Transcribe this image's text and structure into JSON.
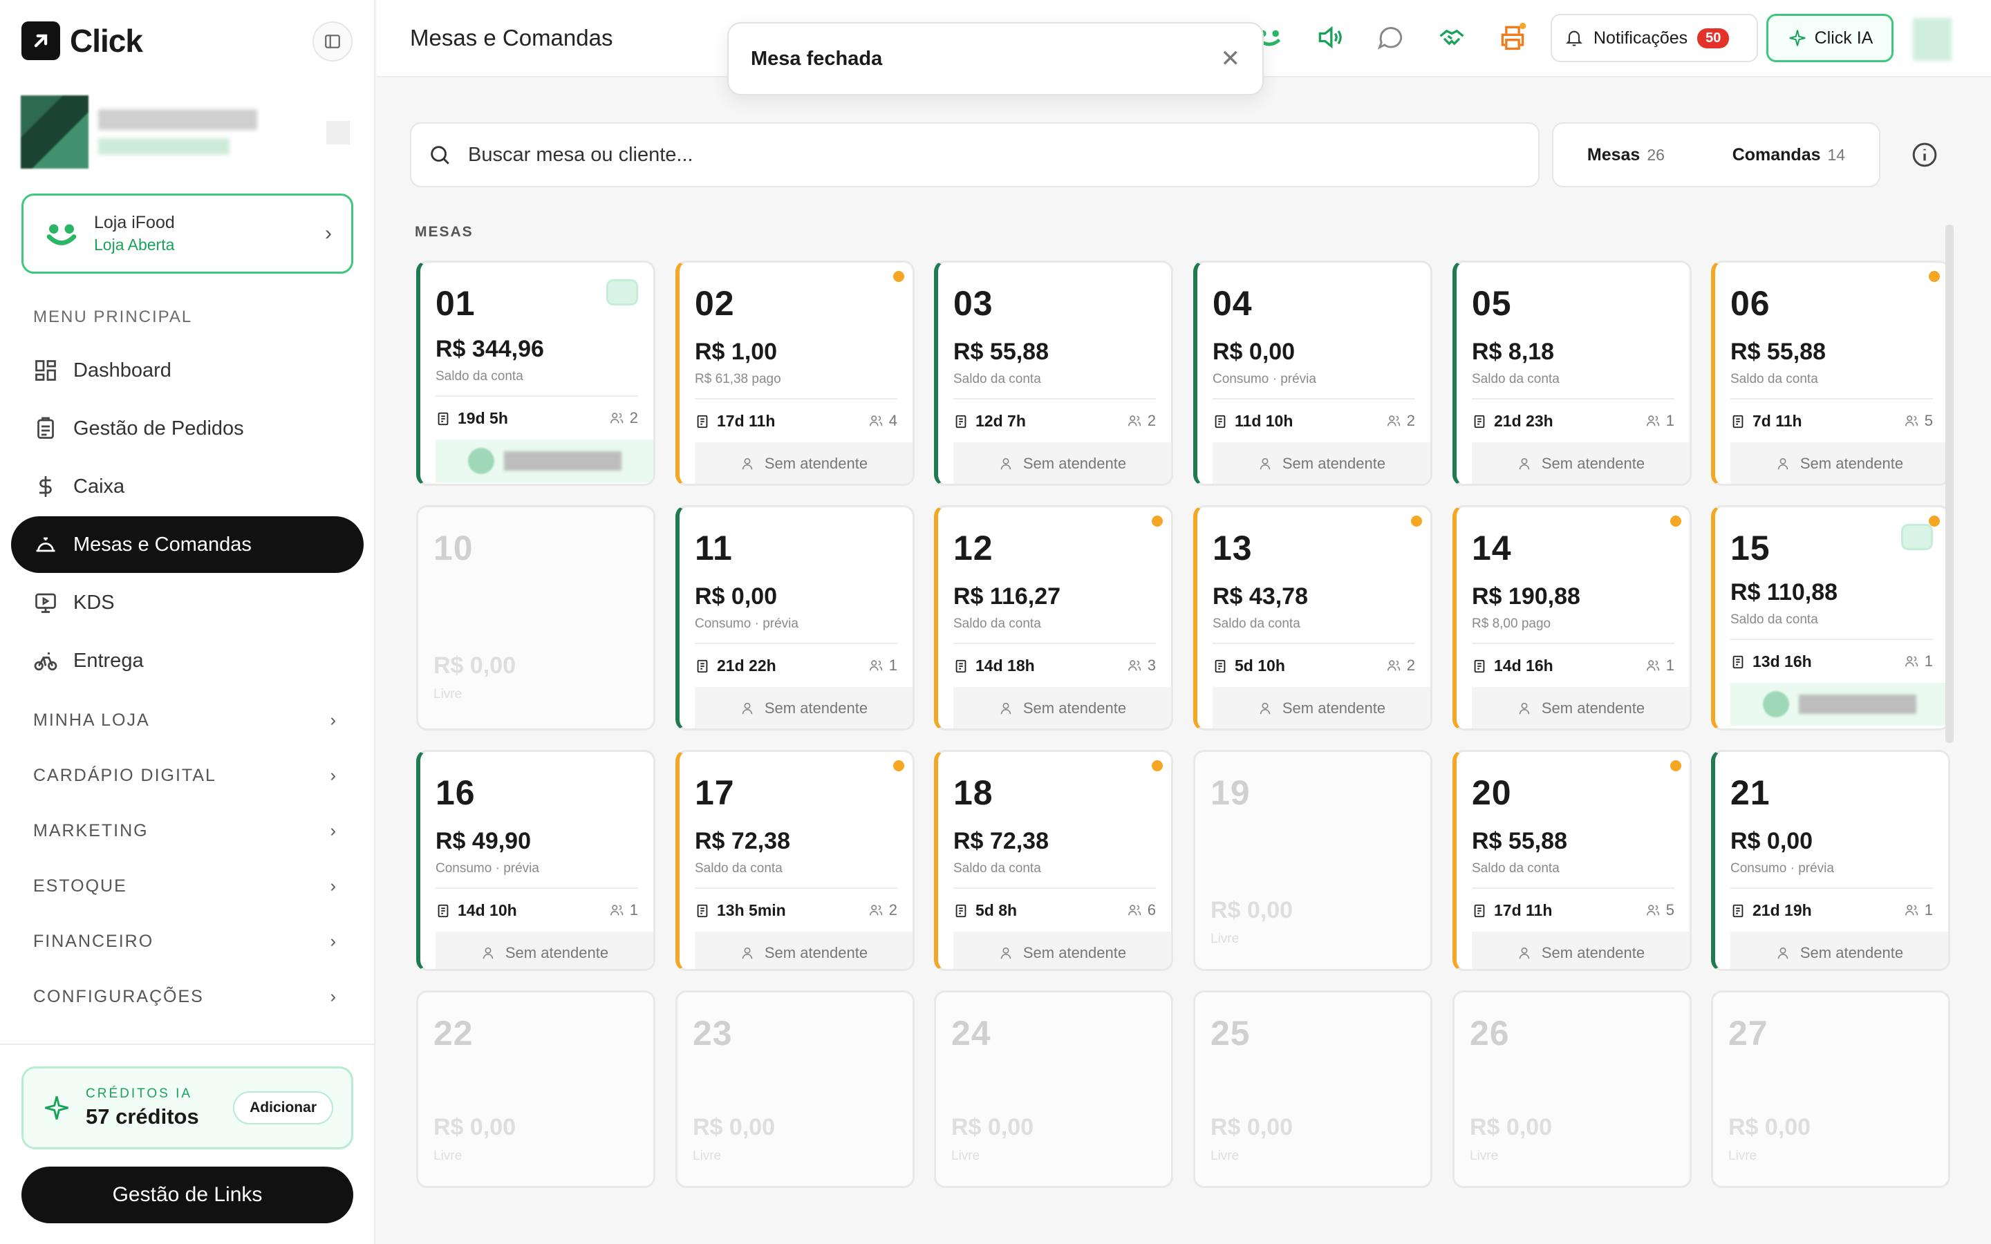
{
  "app": {
    "name": "Click"
  },
  "ifood": {
    "title": "Loja iFood",
    "status": "Loja Aberta"
  },
  "sidebar": {
    "section_main": "MENU PRINCIPAL",
    "items": [
      {
        "label": "Dashboard",
        "icon": "grid-icon"
      },
      {
        "label": "Gestão de Pedidos",
        "icon": "clipboard-icon"
      },
      {
        "label": "Caixa",
        "icon": "dollar-icon"
      },
      {
        "label": "Mesas e Comandas",
        "icon": "cloche-icon",
        "active": true
      },
      {
        "label": "KDS",
        "icon": "monitor-icon"
      },
      {
        "label": "Entrega",
        "icon": "bike-icon"
      }
    ],
    "groups": [
      "MINHA LOJA",
      "CARDÁPIO DIGITAL",
      "MARKETING",
      "ESTOQUE",
      "FINANCEIRO",
      "CONFIGURAÇÕES"
    ],
    "credits": {
      "title": "CRÉDITOS IA",
      "value": "57 créditos",
      "add": "Adicionar"
    },
    "links_button": "Gestão de Links"
  },
  "header": {
    "title": "Mesas e Comandas",
    "notifications_label": "Notificações",
    "notifications_count": "50",
    "ia_label": "Click IA"
  },
  "toast": {
    "message": "Mesa fechada"
  },
  "search": {
    "placeholder": "Buscar mesa ou cliente..."
  },
  "tabs": [
    {
      "label": "Mesas",
      "count": "26"
    },
    {
      "label": "Comandas",
      "count": "14"
    }
  ],
  "section_title": "MESAS",
  "colors": {
    "green": "#1f7a4f",
    "orange": "#f5a623",
    "accent": "#3ec77d",
    "badge": "#e4322b"
  },
  "tables": [
    {
      "num": "01",
      "value": "R$ 344,96",
      "sub": "Saldo da conta",
      "time": "19d 5h",
      "people": "2",
      "state": "green",
      "attendant": "",
      "icon": true,
      "dot": false
    },
    {
      "num": "02",
      "value": "R$ 1,00",
      "sub": "R$ 61,38 pago",
      "time": "17d 11h",
      "people": "4",
      "state": "orange",
      "attendant": "Sem atendente",
      "icon": false,
      "dot": true
    },
    {
      "num": "03",
      "value": "R$ 55,88",
      "sub": "Saldo da conta",
      "time": "12d 7h",
      "people": "2",
      "state": "green",
      "attendant": "Sem atendente",
      "icon": false,
      "dot": false
    },
    {
      "num": "04",
      "value": "R$ 0,00",
      "sub": "Consumo · prévia",
      "time": "11d 10h",
      "people": "2",
      "state": "green",
      "attendant": "Sem atendente",
      "icon": false,
      "dot": false
    },
    {
      "num": "05",
      "value": "R$ 8,18",
      "sub": "Saldo da conta",
      "time": "21d 23h",
      "people": "1",
      "state": "green",
      "attendant": "Sem atendente",
      "icon": false,
      "dot": false
    },
    {
      "num": "06",
      "value": "R$ 55,88",
      "sub": "Saldo da conta",
      "time": "7d 11h",
      "people": "5",
      "state": "orange",
      "attendant": "Sem atendente",
      "icon": false,
      "dot": true
    },
    {
      "num": "10",
      "value": "R$ 0,00",
      "sub": "Livre",
      "state": "free"
    },
    {
      "num": "11",
      "value": "R$ 0,00",
      "sub": "Consumo · prévia",
      "time": "21d 22h",
      "people": "1",
      "state": "green",
      "attendant": "Sem atendente",
      "icon": false,
      "dot": false
    },
    {
      "num": "12",
      "value": "R$ 116,27",
      "sub": "Saldo da conta",
      "time": "14d 18h",
      "people": "3",
      "state": "orange",
      "attendant": "Sem atendente",
      "icon": false,
      "dot": true
    },
    {
      "num": "13",
      "value": "R$ 43,78",
      "sub": "Saldo da conta",
      "time": "5d 10h",
      "people": "2",
      "state": "orange",
      "attendant": "Sem atendente",
      "icon": false,
      "dot": true
    },
    {
      "num": "14",
      "value": "R$ 190,88",
      "sub": "R$ 8,00 pago",
      "time": "14d 16h",
      "people": "1",
      "state": "orange",
      "attendant": "Sem atendente",
      "icon": false,
      "dot": true
    },
    {
      "num": "15",
      "value": "R$ 110,88",
      "sub": "Saldo da conta",
      "time": "13d 16h",
      "people": "1",
      "state": "orange",
      "attendant": "",
      "icon": true,
      "dot": true
    },
    {
      "num": "16",
      "value": "R$ 49,90",
      "sub": "Consumo · prévia",
      "time": "14d 10h",
      "people": "1",
      "state": "green",
      "attendant": "Sem atendente",
      "icon": false,
      "dot": false
    },
    {
      "num": "17",
      "value": "R$ 72,38",
      "sub": "Saldo da conta",
      "time": "13h 5min",
      "people": "2",
      "state": "orange",
      "attendant": "Sem atendente",
      "icon": false,
      "dot": true
    },
    {
      "num": "18",
      "value": "R$ 72,38",
      "sub": "Saldo da conta",
      "time": "5d 8h",
      "people": "6",
      "state": "orange",
      "attendant": "Sem atendente",
      "icon": false,
      "dot": true
    },
    {
      "num": "19",
      "value": "R$ 0,00",
      "sub": "Livre",
      "state": "free"
    },
    {
      "num": "20",
      "value": "R$ 55,88",
      "sub": "Saldo da conta",
      "time": "17d 11h",
      "people": "5",
      "state": "orange",
      "attendant": "Sem atendente",
      "icon": false,
      "dot": true
    },
    {
      "num": "21",
      "value": "R$ 0,00",
      "sub": "Consumo · prévia",
      "time": "21d 19h",
      "people": "1",
      "state": "green",
      "attendant": "Sem atendente",
      "icon": false,
      "dot": false
    },
    {
      "num": "22",
      "value": "R$ 0,00",
      "sub": "Livre",
      "state": "free"
    },
    {
      "num": "23",
      "value": "R$ 0,00",
      "sub": "Livre",
      "state": "free"
    },
    {
      "num": "24",
      "value": "R$ 0,00",
      "sub": "Livre",
      "state": "free"
    },
    {
      "num": "25",
      "value": "R$ 0,00",
      "sub": "Livre",
      "state": "free"
    },
    {
      "num": "26",
      "value": "R$ 0,00",
      "sub": "Livre",
      "state": "free"
    },
    {
      "num": "27",
      "value": "R$ 0,00",
      "sub": "Livre",
      "state": "free"
    }
  ]
}
